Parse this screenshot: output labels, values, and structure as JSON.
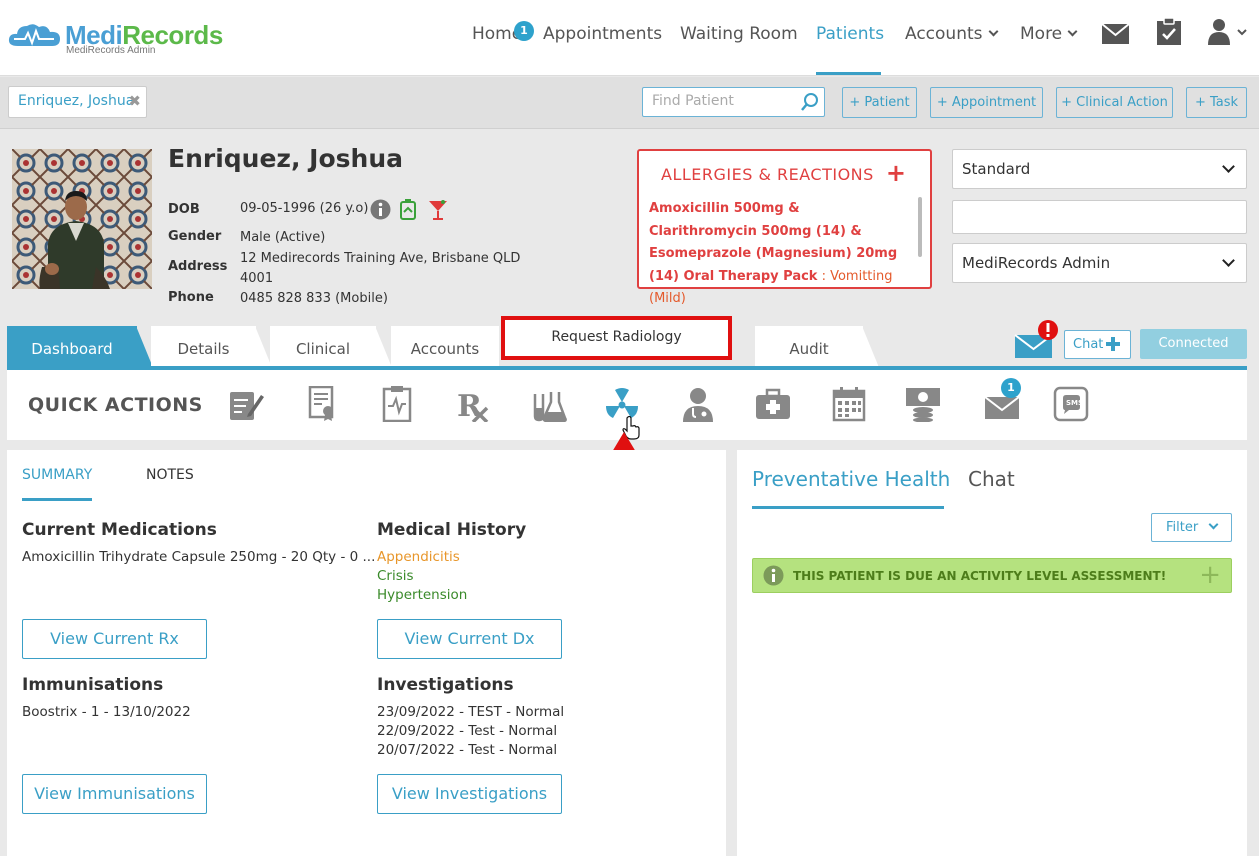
{
  "app": {
    "brand_part1": "Medi",
    "brand_part2": "Records",
    "subtitle": "MediRecords Admin"
  },
  "nav": {
    "home": "Home",
    "home_badge": "1",
    "appointments": "Appointments",
    "waiting_room": "Waiting Room",
    "patients": "Patients",
    "accounts": "Accounts",
    "more": "More"
  },
  "toolbar": {
    "patient_tab": "Enriquez, Joshua",
    "find_placeholder": "Find Patient",
    "add_patient": "+ Patient",
    "add_appointment": "+ Appointment",
    "add_clinical_action": "+ Clinical Action",
    "add_task": "+ Task"
  },
  "patient": {
    "name": "Enriquez, Joshua",
    "dob_label": "DOB",
    "dob": "09-05-1996 (26 y.o)",
    "gender_label": "Gender",
    "gender": "Male (Active)",
    "address_label": "Address",
    "address_line1": "12 Medirecords Training Ave, Brisbane QLD",
    "address_line2": "4001",
    "phone_label": "Phone",
    "phone": "0485 828 833 (Mobile)"
  },
  "allergies": {
    "title": "ALLERGIES & REACTIONS",
    "item": "Amoxicillin 500mg & Clarithromycin 500mg (14) & Esomeprazole (Magnesium) 20mg (14) Oral Therapy Pack",
    "reaction": " : Vomitting (Mild)"
  },
  "selects": {
    "first": "Standard",
    "second": "",
    "third": "MediRecords Admin"
  },
  "tabs": {
    "dashboard": "Dashboard",
    "details": "Details",
    "clinical": "Clinical",
    "accounts": "Accounts",
    "request_radiology": "Request Radiology",
    "audit": "Audit"
  },
  "chat_button": "Chat",
  "connected": "Connected",
  "quick_actions": {
    "title": "QUICK ACTIONS",
    "mail_badge": "1",
    "sms": "SMS"
  },
  "summary": {
    "tab_summary": "SUMMARY",
    "tab_notes": "NOTES",
    "current_meds_title": "Current Medications",
    "current_meds": "Amoxicillin Trihydrate Capsule 250mg - 20 Qty - 0 ...",
    "medical_history_title": "Medical History",
    "history": [
      "Appendicitis",
      "Crisis",
      "Hypertension"
    ],
    "view_rx": "View Current Rx",
    "view_dx": "View Current Dx",
    "immunisations_title": "Immunisations",
    "immunisations": "Boostrix - 1 - 13/10/2022",
    "investigations_title": "Investigations",
    "investigations": [
      "23/09/2022 - TEST - Normal",
      "22/09/2022 - Test - Normal",
      "20/07/2022 - Test - Normal"
    ],
    "view_immunisations": "View Immunisations",
    "view_investigations": "View Investigations"
  },
  "right_panel": {
    "tab_preventative": "Preventative Health",
    "tab_chat": "Chat",
    "filter": "Filter",
    "alert": "THIS PATIENT IS DUE AN ACTIVITY LEVEL ASSESSMENT!"
  },
  "colors": {
    "accent": "#3a9fc6",
    "allergy": "#e04040",
    "highlight": "#e01010",
    "alert_bg": "#b5e27f"
  }
}
